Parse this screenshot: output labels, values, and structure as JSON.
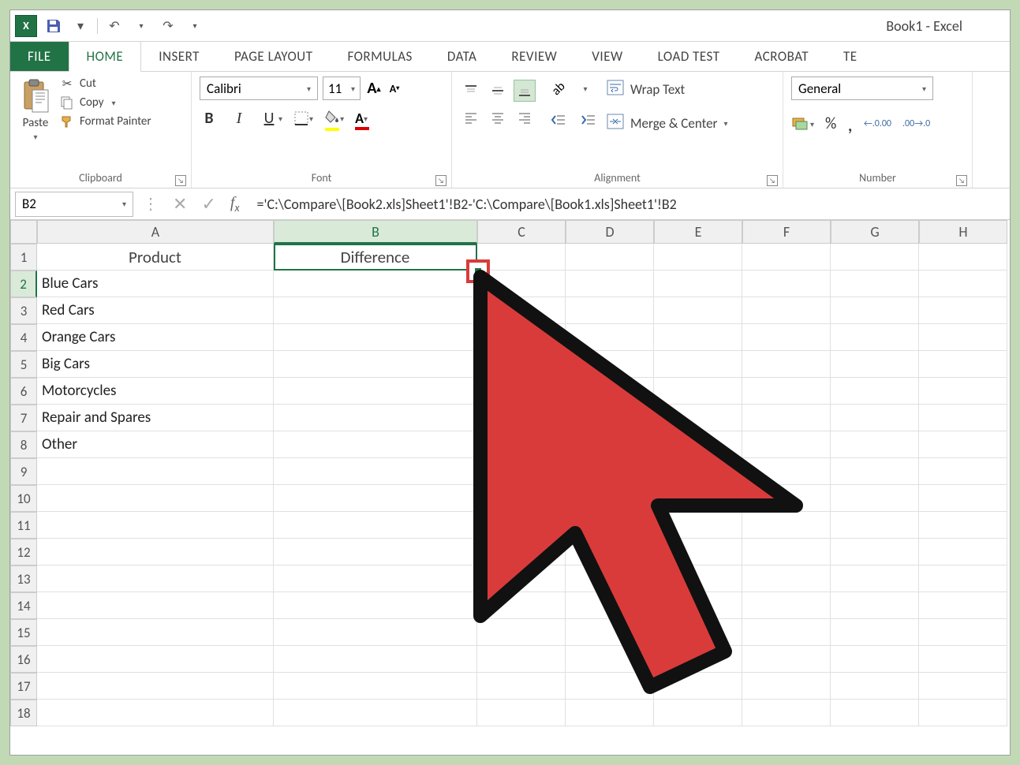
{
  "titlebar": {
    "title": "Book1 - Excel"
  },
  "tabs": {
    "file": "FILE",
    "home": "HOME",
    "insert": "INSERT",
    "page_layout": "PAGE LAYOUT",
    "formulas": "FORMULAS",
    "data": "DATA",
    "review": "REVIEW",
    "view": "VIEW",
    "load_test": "LOAD TEST",
    "acrobat": "ACROBAT",
    "te": "TE"
  },
  "ribbon": {
    "clipboard": {
      "paste": "Paste",
      "cut": "Cut",
      "copy": "Copy",
      "format_painter": "Format Painter",
      "group_label": "Clipboard"
    },
    "font": {
      "name": "Calibri",
      "size": "11",
      "group_label": "Font"
    },
    "alignment": {
      "wrap": "Wrap Text",
      "merge": "Merge & Center",
      "group_label": "Alignment"
    },
    "number": {
      "format": "General",
      "dec_dec": ".00→.0",
      "dec_inc": ".0→.00",
      "group_label": "Number"
    }
  },
  "formula_bar": {
    "name_box": "B2",
    "formula": "='C:\\Compare\\[Book2.xls]Sheet1'!B2-'C:\\Compare\\[Book1.xls]Sheet1'!B2"
  },
  "columns": [
    "A",
    "B",
    "C",
    "D",
    "E",
    "F",
    "G",
    "H"
  ],
  "rows": [
    1,
    2,
    3,
    4,
    5,
    6,
    7,
    8,
    9,
    10,
    11,
    12,
    13,
    14,
    15,
    16,
    17,
    18
  ],
  "cells": {
    "A1": "Product",
    "B1": "Difference",
    "A2": "Blue Cars",
    "A3": "Red Cars",
    "A4": "Orange Cars",
    "A5": "Big Cars",
    "A6": "Motorcycles",
    "A7": "Repair and Spares",
    "A8": "Other"
  },
  "active_cell": "B2",
  "colors": {
    "excel_green": "#217346",
    "annotation_red": "#d93b3b"
  }
}
